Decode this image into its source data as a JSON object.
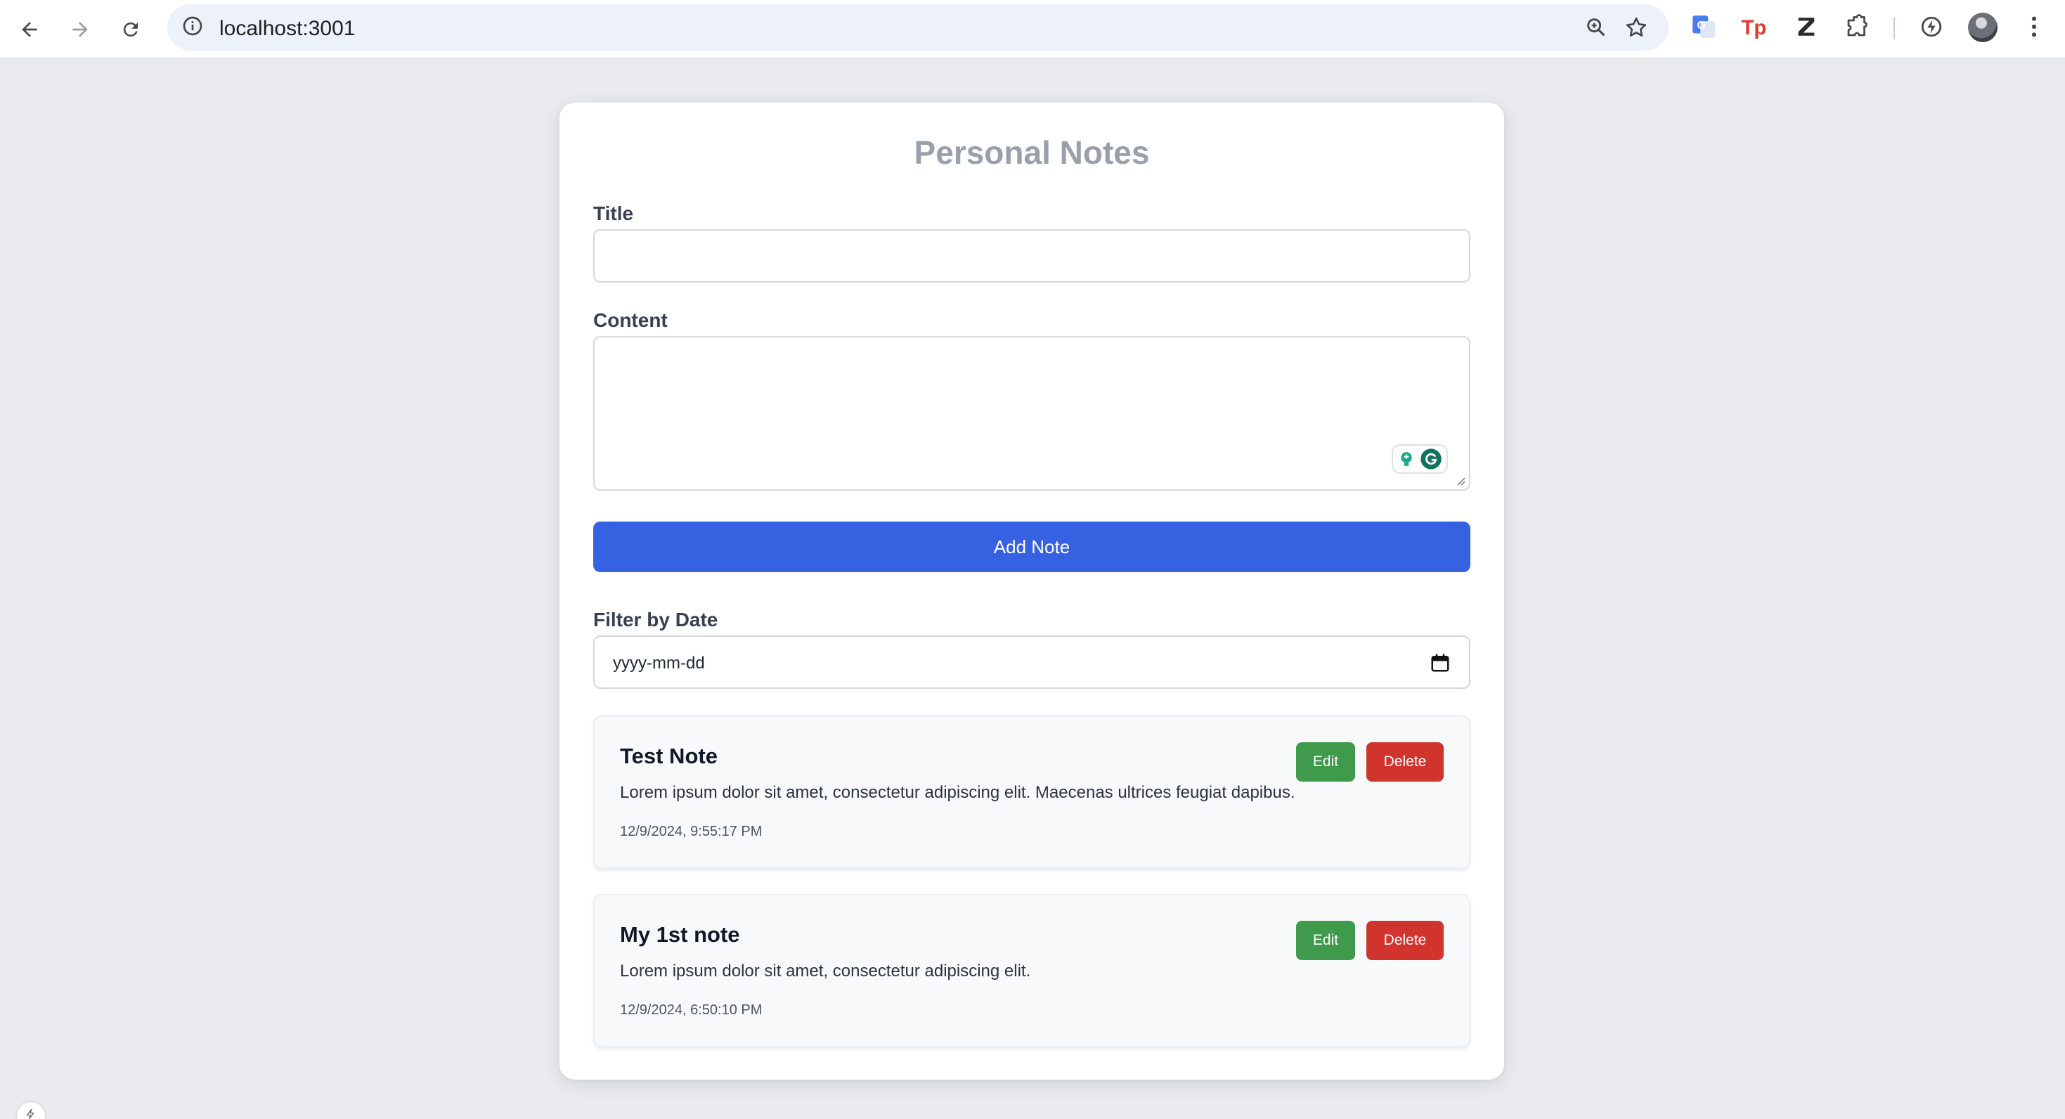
{
  "browser": {
    "url": "localhost:3001"
  },
  "app": {
    "title": "Personal Notes",
    "title_label": "Title",
    "title_value": "",
    "content_label": "Content",
    "content_value": "",
    "add_button": "Add Note",
    "filter_label": "Filter by Date",
    "filter_placeholder": "yyyy-mm-dd"
  },
  "notes": [
    {
      "title": "Test Note",
      "content": "Lorem ipsum dolor sit amet, consectetur adipiscing elit. Maecenas ultrices feugiat dapibus.",
      "date": "12/9/2024, 9:55:17 PM",
      "edit_label": "Edit",
      "delete_label": "Delete"
    },
    {
      "title": "My 1st note",
      "content": "Lorem ipsum dolor sit amet, consectetur adipiscing elit.",
      "date": "12/9/2024, 6:50:10 PM",
      "edit_label": "Edit",
      "delete_label": "Delete"
    }
  ],
  "colors": {
    "primary": "#3661e1",
    "edit": "#3f9a4c",
    "delete": "#d0342c",
    "title": "#9aa0ab"
  },
  "icons": {
    "back": "arrow-left-icon",
    "forward": "arrow-right-icon",
    "reload": "reload-icon",
    "info": "info-icon",
    "zoom": "zoom-icon",
    "bookmark": "star-icon",
    "translate": "google-translate-icon",
    "extension_tp": "tp-extension-icon",
    "extension_z": "z-extension-icon",
    "extensions": "puzzle-icon",
    "performance": "performance-icon",
    "menu": "kebab-menu-icon",
    "calendar": "calendar-icon",
    "grammarly": "grammarly-icon"
  }
}
